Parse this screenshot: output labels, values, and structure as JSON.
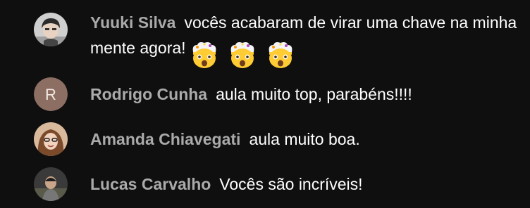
{
  "comments": [
    {
      "author": "Yuuki Silva",
      "text": "vocês acabaram de virar uma chave na minha mente agora!",
      "emojis": [
        "exploding-head-icon",
        "exploding-head-icon",
        "exploding-head-icon"
      ],
      "avatar": "photo"
    },
    {
      "author": "Rodrigo Cunha",
      "text": "aula muito top, parabéns!!!!",
      "avatar_letter": "R",
      "avatar_color": "#8d6e63"
    },
    {
      "author": "Amanda Chiavegati",
      "text": "aula muito boa.",
      "avatar": "photo"
    },
    {
      "author": "Lucas Carvalho",
      "text": "Vocês são incríveis!",
      "avatar": "photo"
    }
  ],
  "colors": {
    "background": "#0f0f0f",
    "author": "#aaaaaa",
    "message": "#ffffff"
  }
}
